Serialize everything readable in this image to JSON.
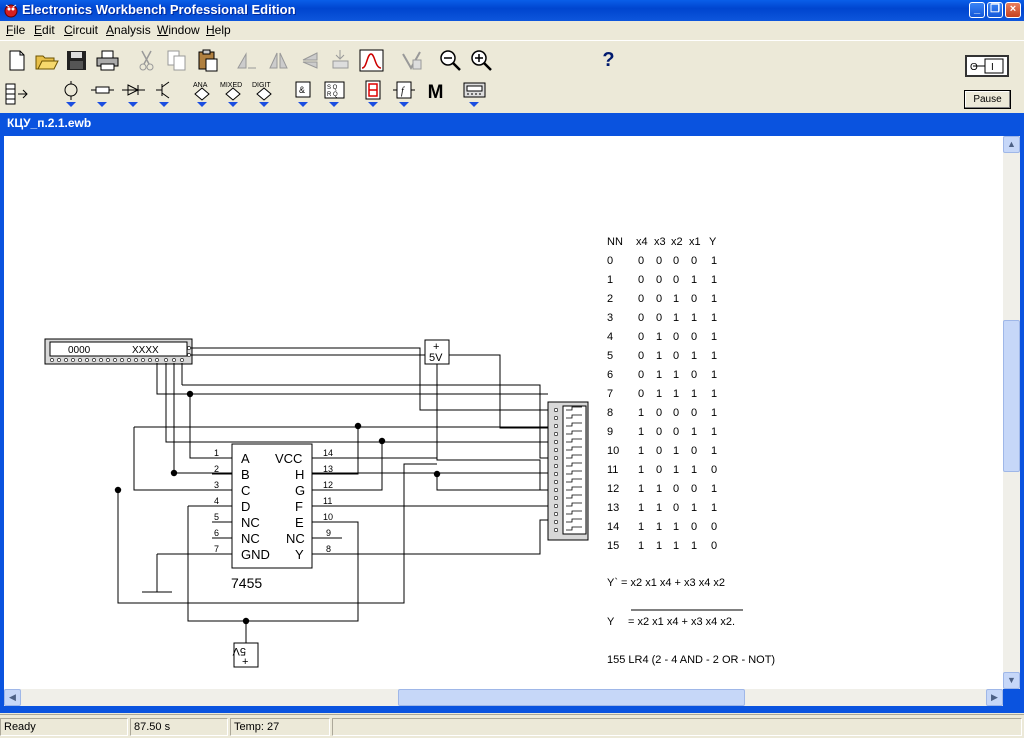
{
  "app": {
    "title": "Electronics Workbench Professional Edition"
  },
  "menu": [
    {
      "mnemonic": "F",
      "rest": "ile"
    },
    {
      "mnemonic": "E",
      "rest": "dit"
    },
    {
      "mnemonic": "C",
      "rest": "ircuit"
    },
    {
      "mnemonic": "A",
      "rest": "nalysis"
    },
    {
      "mnemonic": "W",
      "rest": "indow"
    },
    {
      "mnemonic": "H",
      "rest": "elp"
    }
  ],
  "toolbar": {
    "help_label": "?",
    "pause_label": "Pause",
    "ana_label": "ANA",
    "mixed_label": "MIXED",
    "digit_label": "DIGIT",
    "misc_label": "M"
  },
  "document": {
    "title": "КЦУ_п.2.1.ewb"
  },
  "schematic": {
    "word_generator": {
      "left": "0000",
      "right": "XXXX"
    },
    "vcc_label": "5V",
    "vcc_plus": "+",
    "gnd_ref_label": "5V",
    "ic": {
      "name": "7455",
      "left_pins": [
        {
          "num": "1",
          "name": "A"
        },
        {
          "num": "2",
          "name": "B"
        },
        {
          "num": "3",
          "name": "C"
        },
        {
          "num": "4",
          "name": "D"
        },
        {
          "num": "5",
          "name": "NC"
        },
        {
          "num": "6",
          "name": "NC"
        },
        {
          "num": "7",
          "name": "GND"
        }
      ],
      "right_pins": [
        {
          "num": "14",
          "name": "VCC"
        },
        {
          "num": "13",
          "name": "H"
        },
        {
          "num": "12",
          "name": "G"
        },
        {
          "num": "11",
          "name": "F"
        },
        {
          "num": "10",
          "name": "E"
        },
        {
          "num": "9",
          "name": "NC"
        },
        {
          "num": "8",
          "name": "Y"
        }
      ]
    }
  },
  "truth_table": {
    "headers": [
      "NN",
      "x4",
      "x3",
      "x2",
      "x1",
      "Y"
    ],
    "rows": [
      [
        "0",
        "0",
        "0",
        "0",
        "0",
        "1"
      ],
      [
        "1",
        "0",
        "0",
        "0",
        "1",
        "1"
      ],
      [
        "2",
        "0",
        "0",
        "1",
        "0",
        "1"
      ],
      [
        "3",
        "0",
        "0",
        "1",
        "1",
        "1"
      ],
      [
        "4",
        "0",
        "1",
        "0",
        "0",
        "1"
      ],
      [
        "5",
        "0",
        "1",
        "0",
        "1",
        "1"
      ],
      [
        "6",
        "0",
        "1",
        "1",
        "0",
        "1"
      ],
      [
        "7",
        "0",
        "1",
        "1",
        "1",
        "1"
      ],
      [
        "8",
        "1",
        "0",
        "0",
        "0",
        "1"
      ],
      [
        "9",
        "1",
        "0",
        "0",
        "1",
        "1"
      ],
      [
        "10",
        "1",
        "0",
        "1",
        "0",
        "1"
      ],
      [
        "11",
        "1",
        "0",
        "1",
        "1",
        "0"
      ],
      [
        "12",
        "1",
        "1",
        "0",
        "0",
        "1"
      ],
      [
        "13",
        "1",
        "1",
        "0",
        "1",
        "1"
      ],
      [
        "14",
        "1",
        "1",
        "1",
        "0",
        "0"
      ],
      [
        "15",
        "1",
        "1",
        "1",
        "1",
        "0"
      ]
    ],
    "formula1": "Y` =  x2 x1 x4  +  x3 x4 x2",
    "formula2_lhs": "Y",
    "formula2_rhs": "= x2 x1 x4  +  x3 x4 x2.",
    "chip_note": "155 LR4   (2 - 4 AND - 2 OR - NOT)"
  },
  "status": {
    "state": "Ready",
    "time": "87.50 s",
    "temp": "Temp:  27"
  }
}
